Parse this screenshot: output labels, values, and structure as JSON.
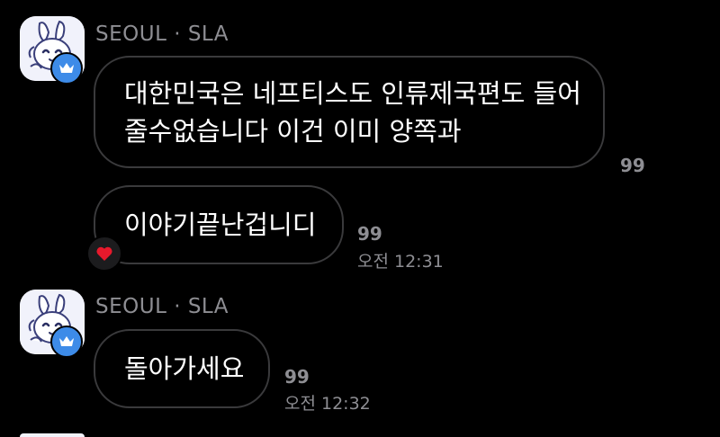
{
  "messages": [
    {
      "sender": "SEOUL · SLA",
      "bubbles": [
        {
          "line1": "대한민국은 네프티스도 인류제국편도 들어",
          "line2": "줄수없습니다 이건 이미 양쪽과",
          "read_count": "99",
          "time": ""
        },
        {
          "text": "이야기끝난겁니디",
          "read_count": "99",
          "time": "오전 12:31",
          "reaction": "heart-reaction"
        }
      ]
    },
    {
      "sender": "SEOUL · SLA",
      "bubbles": [
        {
          "text": "돌아가세요",
          "read_count": "99",
          "time": "오전 12:32"
        }
      ]
    }
  ],
  "colors": {
    "background": "#000000",
    "bubble_border": "#3a3a3c",
    "meta_text": "#8e8e93",
    "badge": "#3d8be8",
    "heart": "#e8192c"
  },
  "icons": {
    "avatar": "white-rabbit-avatar-icon",
    "badge": "crown-icon",
    "reaction": "heart-icon"
  }
}
